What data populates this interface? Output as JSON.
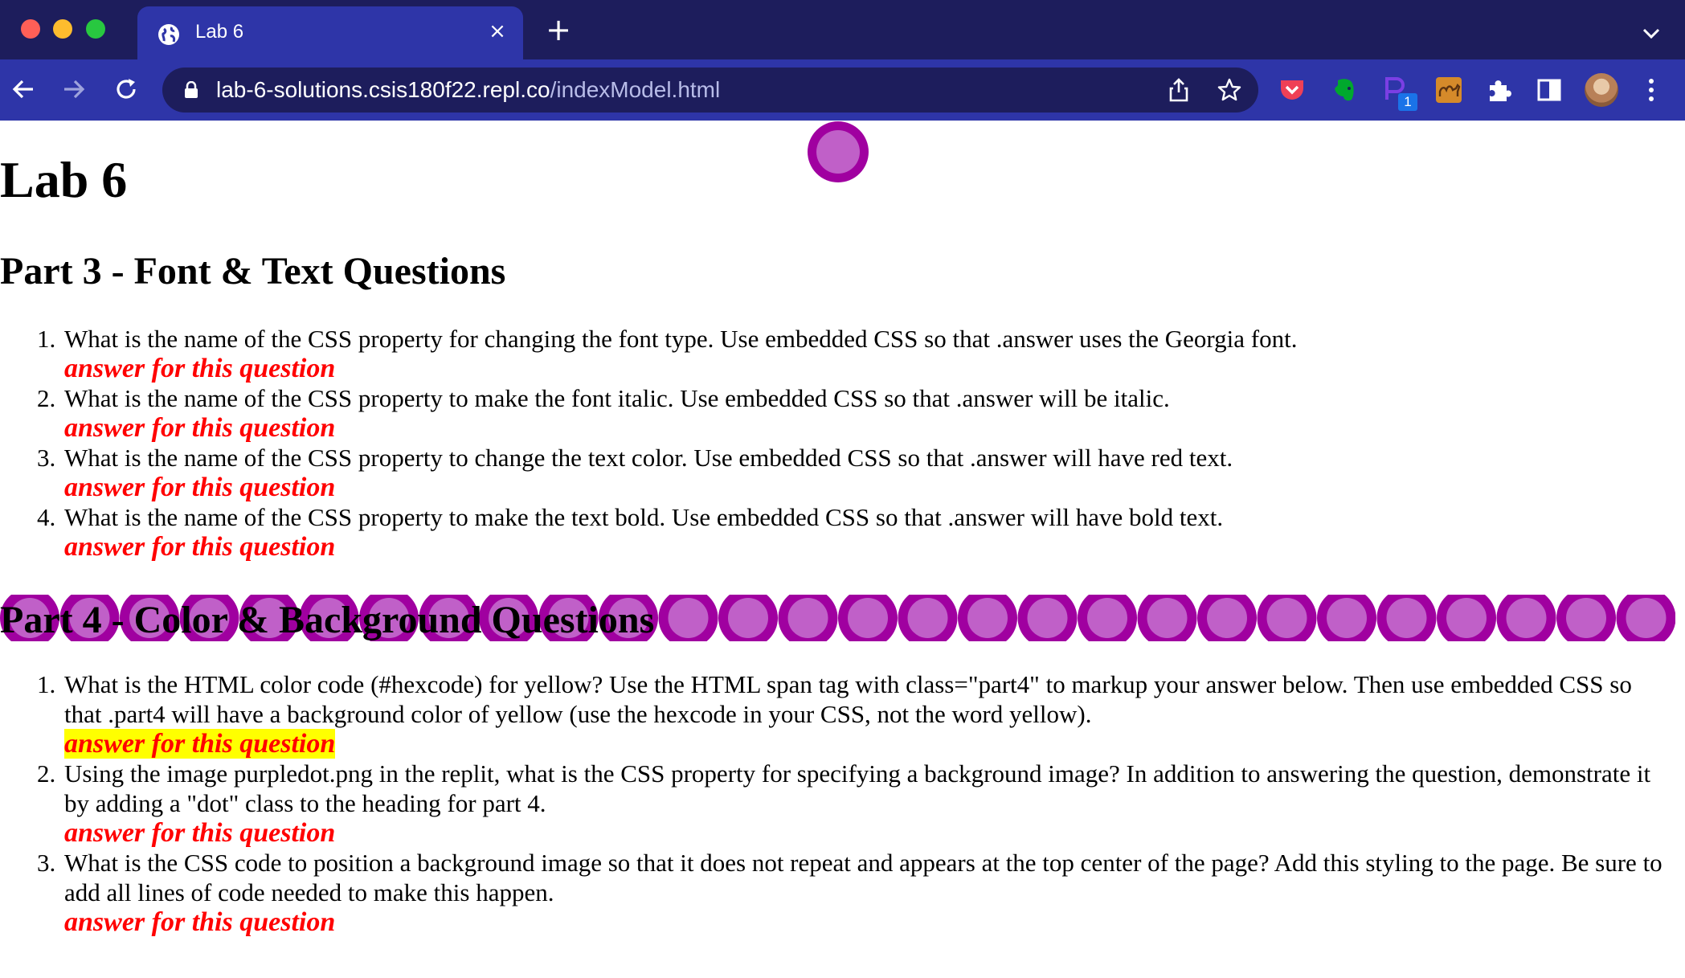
{
  "browser": {
    "tab_title": "Lab 6",
    "tab_close": "×",
    "new_tab": "+",
    "url_host": "lab-6-solutions.csis180f22.repl.co",
    "url_path": "/indexModel.html",
    "extension_badge": "1"
  },
  "page": {
    "title": "Lab 6",
    "part3": {
      "heading": "Part 3 - Font & Text Questions",
      "questions": [
        {
          "num": "1.",
          "text": "What is the name of the CSS property for changing the font type. Use embedded CSS so that .answer uses the Georgia font.",
          "answer": "answer for this question"
        },
        {
          "num": "2.",
          "text": "What is the name of the CSS property to make the font italic. Use embedded CSS so that .answer will be italic.",
          "answer": "answer for this question"
        },
        {
          "num": "3.",
          "text": "What is the name of the CSS property to change the text color. Use embedded CSS so that .answer will have red text.",
          "answer": "answer for this question"
        },
        {
          "num": "4.",
          "text": "What is the name of the CSS property to make the text bold. Use embedded CSS so that .answer will have bold text.",
          "answer": "answer for this question"
        }
      ]
    },
    "part4": {
      "heading": "Part 4 - Color & Background Questions",
      "questions": [
        {
          "num": "1.",
          "text": "What is the HTML color code (#hexcode) for yellow? Use the HTML span tag with class=\"part4\" to markup your answer below. Then use embedded CSS so that .part4 will have a background color of yellow (use the hexcode in your CSS, not the word yellow).",
          "answer": "answer for this question"
        },
        {
          "num": "2.",
          "text": "Using the image purpledot.png in the replit, what is the CSS property for specifying a background image? In addition to answering the question, demonstrate it by adding a \"dot\" class to the heading for part 4.",
          "answer": "answer for this question"
        },
        {
          "num": "3.",
          "text": "What is the CSS code to position a background image so that it does not repeat and appears at the top center of the page? Add this styling to the page. Be sure to add all lines of code needed to make this happen.",
          "answer": "answer for this question"
        }
      ]
    }
  },
  "colors": {
    "answer": "#ff0000",
    "highlight": "#ffff00",
    "dot_outer": "#a000a0",
    "dot_inner": "#c060c8"
  }
}
